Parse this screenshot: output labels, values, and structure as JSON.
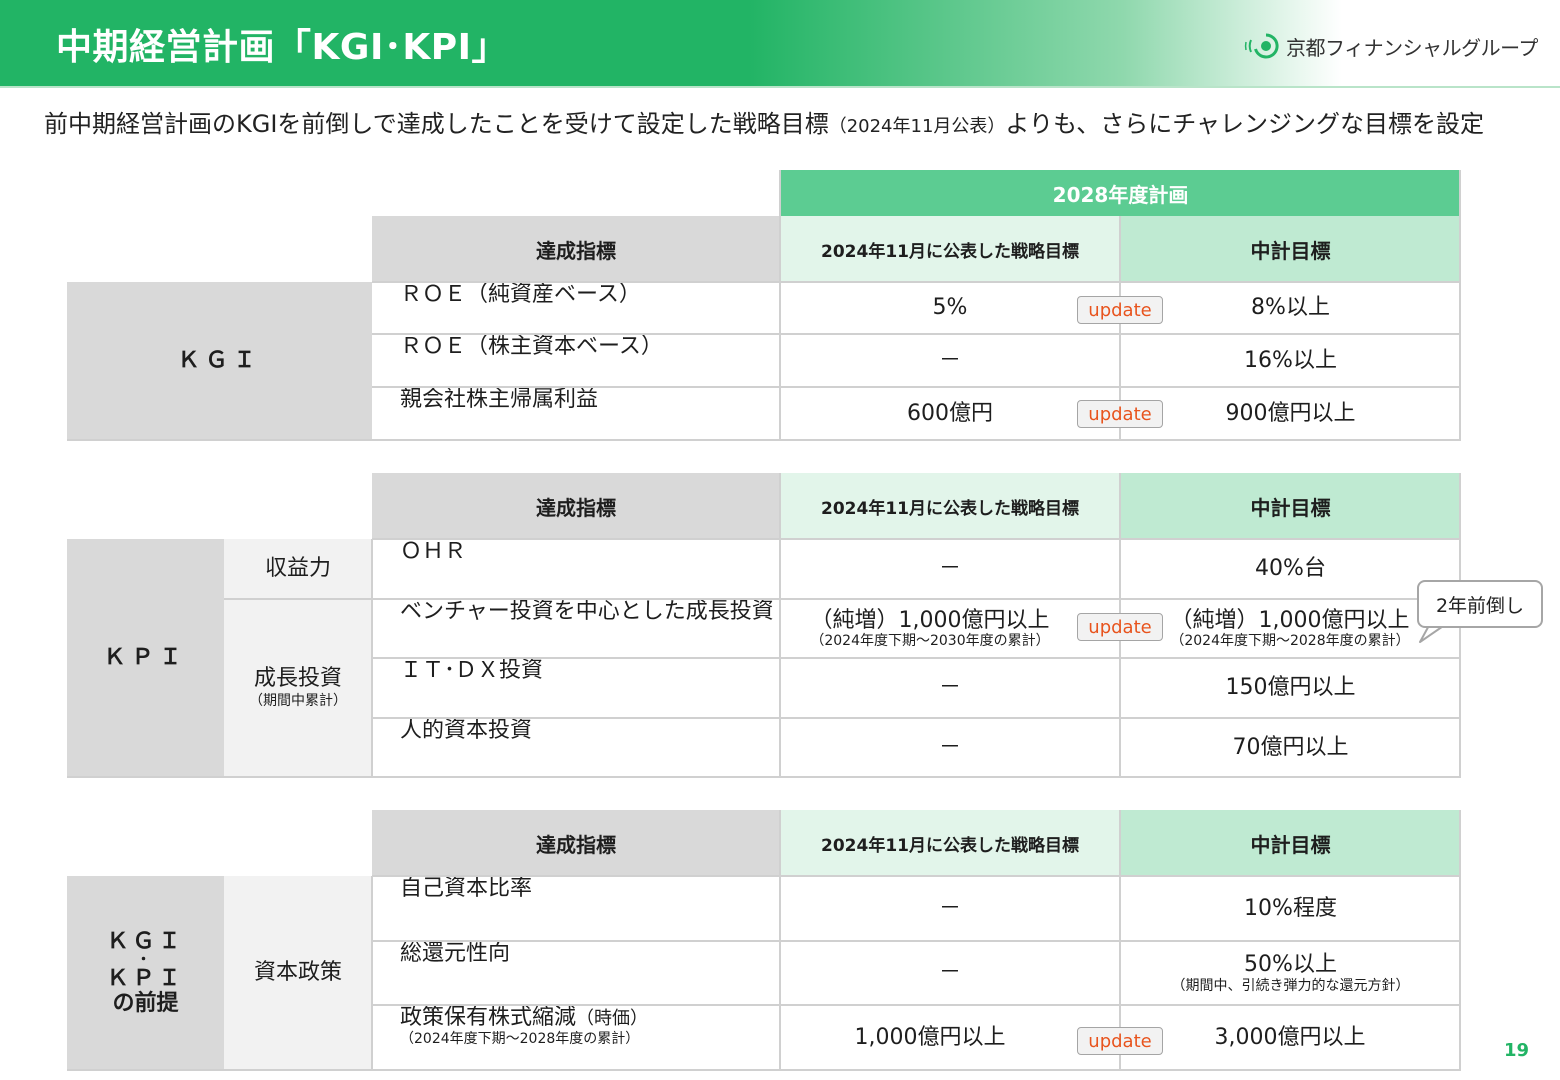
{
  "header": {
    "title": "中期経営計画「KGI･KPI」",
    "logo_text": "京都フィナンシャルグループ",
    "brand_color": "#22b465"
  },
  "subtitle": {
    "main": "前中期経営計画のKGIを前倒しで達成したことを受けて設定した戦略目標",
    "paren": "（2024年11月公表）",
    "tail": "よりも、さらにチャレンジングな目標を設定"
  },
  "plan_header": "2028年度計画",
  "columns": {
    "indicator": "達成指標",
    "strategic": "2024年11月に公表した戦略目標",
    "midterm": "中計目標"
  },
  "kgi": {
    "label": "ＫＧＩ",
    "rows": [
      {
        "indicator": "ＲＯＥ（純資産ベース）",
        "strategic": "5%",
        "midterm": "8%以上",
        "update": "update"
      },
      {
        "indicator": "ＲＯＥ（株主資本ベース）",
        "strategic": "－",
        "midterm": "16%以上"
      },
      {
        "indicator": "親会社株主帰属利益",
        "strategic": "600億円",
        "midterm": "900億円以上",
        "update": "update"
      }
    ]
  },
  "kpi": {
    "label": "ＫＰＩ",
    "cat_earnings": "収益力",
    "cat_growth": "成長投資",
    "cat_growth_sub": "（期間中累計）",
    "rows": [
      {
        "indicator": "ＯＨＲ",
        "strategic": "－",
        "midterm": "40%台"
      },
      {
        "indicator": "ベンチャー投資を中心とした成長投資",
        "strategic": "（純増）1,000億円以上",
        "strategic_sub": "（2024年度下期～2030年度の累計）",
        "midterm": "（純増）1,000億円以上",
        "midterm_sub": "（2024年度下期～2028年度の累計）",
        "update": "update"
      },
      {
        "indicator": "ＩＴ･ＤＸ投資",
        "strategic": "－",
        "midterm": "150億円以上"
      },
      {
        "indicator": "人的資本投資",
        "strategic": "－",
        "midterm": "70億円以上"
      }
    ],
    "callout": "2年前倒し"
  },
  "premise": {
    "label_line1": "ＫＧＩ",
    "label_line2": "・",
    "label_line3": "ＫＰＩ",
    "label_line4": "の前提",
    "category": "資本政策",
    "rows": [
      {
        "indicator": "自己資本比率",
        "strategic": "－",
        "midterm": "10%程度"
      },
      {
        "indicator": "総還元性向",
        "strategic": "－",
        "midterm": "50%以上",
        "midterm_sub": "（期間中、引続き弾力的な還元方針）"
      },
      {
        "indicator": "政策保有株式縮減",
        "indicator_suffix": "（時価）",
        "indicator_sub": "（2024年度下期～2028年度の累計）",
        "strategic": "1,000億円以上",
        "midterm": "3,000億円以上",
        "update": "update"
      }
    ]
  },
  "page_number": "19"
}
